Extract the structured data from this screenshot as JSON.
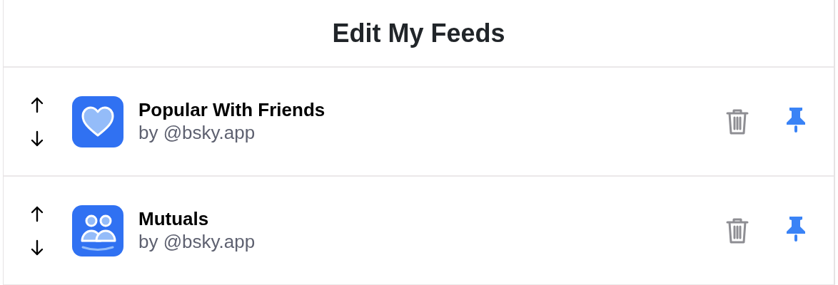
{
  "header": {
    "title": "Edit My Feeds"
  },
  "feeds": [
    {
      "name": "Popular With Friends",
      "author": "by @bsky.app",
      "kind": "heart",
      "pinned": true
    },
    {
      "name": "Mutuals",
      "author": "by @bsky.app",
      "kind": "people",
      "pinned": true
    }
  ]
}
